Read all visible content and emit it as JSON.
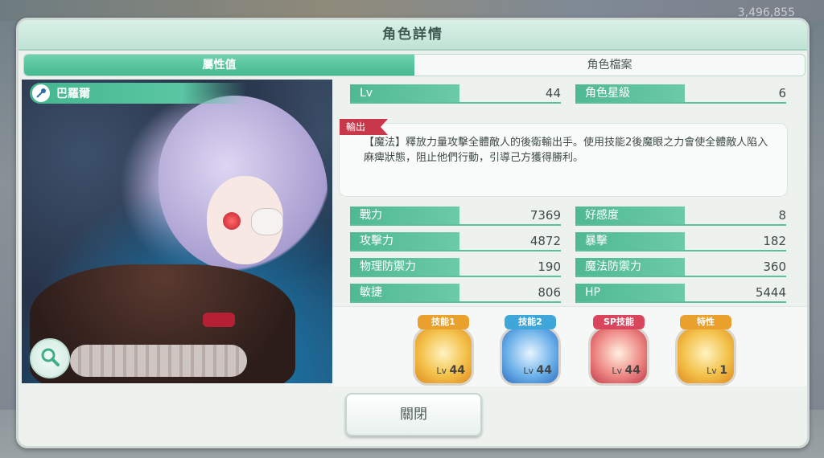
{
  "background": {
    "currency": "3,496,855"
  },
  "dialog": {
    "title": "角色詳情"
  },
  "tabs": [
    {
      "label": "屬性值",
      "active": true
    },
    {
      "label": "角色檔案",
      "active": false
    }
  ],
  "character": {
    "name": "巴羅爾"
  },
  "header_stats": [
    {
      "label": "Lv",
      "value": "44"
    },
    {
      "label": "角色星級",
      "value": "6"
    }
  ],
  "role": {
    "tag": "輸出",
    "description": "【魔法】釋放力量攻擊全體敵人的後衛輸出手。使用技能2後魔眼之力會使全體敵人陷入麻痺狀態，阻止他們行動，引導己方獲得勝利。"
  },
  "stats": [
    {
      "label": "戰力",
      "value": "7369"
    },
    {
      "label": "好感度",
      "value": "8"
    },
    {
      "label": "攻擊力",
      "value": "4872"
    },
    {
      "label": "暴擊",
      "value": "182"
    },
    {
      "label": "物理防禦力",
      "value": "190"
    },
    {
      "label": "魔法防禦力",
      "value": "360"
    },
    {
      "label": "敏捷",
      "value": "806"
    },
    {
      "label": "HP",
      "value": "5444"
    }
  ],
  "skills": [
    {
      "label": "技能1",
      "lv_prefix": "Lv",
      "level": "44",
      "label_color": "#e9a02c",
      "icon_bg": "#f3c14a"
    },
    {
      "label": "技能2",
      "lv_prefix": "Lv",
      "level": "44",
      "label_color": "#3fa6d9",
      "icon_bg": "#6fb3ea"
    },
    {
      "label": "SP技能",
      "lv_prefix": "Lv",
      "level": "44",
      "label_color": "#d9455d",
      "icon_bg": "#ee8a86"
    },
    {
      "label": "特性",
      "lv_prefix": "Lv",
      "level": "1",
      "label_color": "#e9a02c",
      "icon_bg": "#f3c14a"
    }
  ],
  "close_button": {
    "label": "關閉"
  },
  "icons": {
    "name": "wand-icon",
    "zoom": "magnifier-icon"
  }
}
